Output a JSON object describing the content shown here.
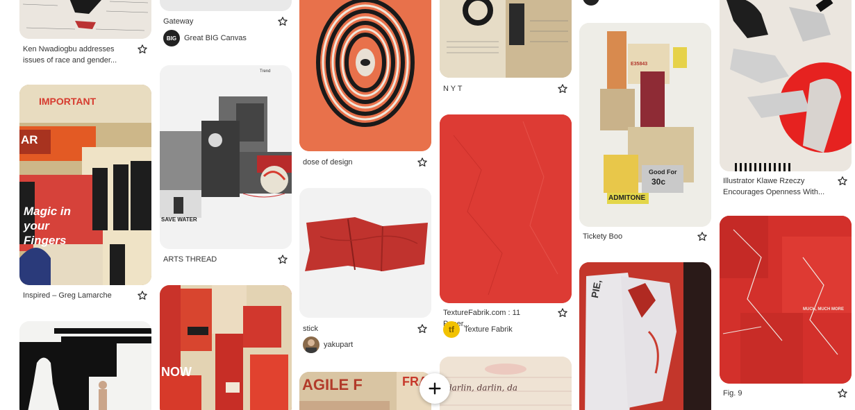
{
  "pins": {
    "ken": {
      "title": "Ken Nwadiogbu addresses issues of race and gender..."
    },
    "greg": {
      "title": "Inspired – Greg Lamarche"
    },
    "gateway": {
      "title": "Gateway",
      "source": "Great BIG Canvas",
      "source_badge": "BIG"
    },
    "arts": {
      "title": "ARTS THREAD"
    },
    "dose": {
      "title": "dose of design"
    },
    "stick": {
      "title": "stick",
      "source": "yakupart"
    },
    "nyt": {
      "title": "N Y T"
    },
    "texture": {
      "title": "TextureFabrik.com : 11 Paper...",
      "source": "Texture Fabrik",
      "source_badge": "tf"
    },
    "tickety": {
      "title": "Tickety Boo"
    },
    "klawe": {
      "title": "Illustrator Klawe Rzeczy Encourages Openness With..."
    },
    "fig9": {
      "title": "Fig. 9"
    }
  },
  "image_text": {
    "important": "IMPORTANT",
    "magic": "Magic in your Fingers",
    "ar": "AR",
    "save_water": "SAVE WATER",
    "trend": "Trend",
    "agile": "AGILE F",
    "fra": "FRA",
    "now": "NOW",
    "good_for": "Good For",
    "price": "30c",
    "admit": "ADMITONE",
    "ticket_no": "E35843",
    "much": "MUCH, MUCH MORE",
    "pie": "PIE,",
    "darlin": "darlin, darlin, da"
  },
  "icons": {
    "star": "star-outline-icon",
    "add": "plus-icon"
  },
  "colors": {
    "accent_red": "#d63b2f",
    "orange": "#e26a43",
    "tan": "#d9c8a4"
  }
}
